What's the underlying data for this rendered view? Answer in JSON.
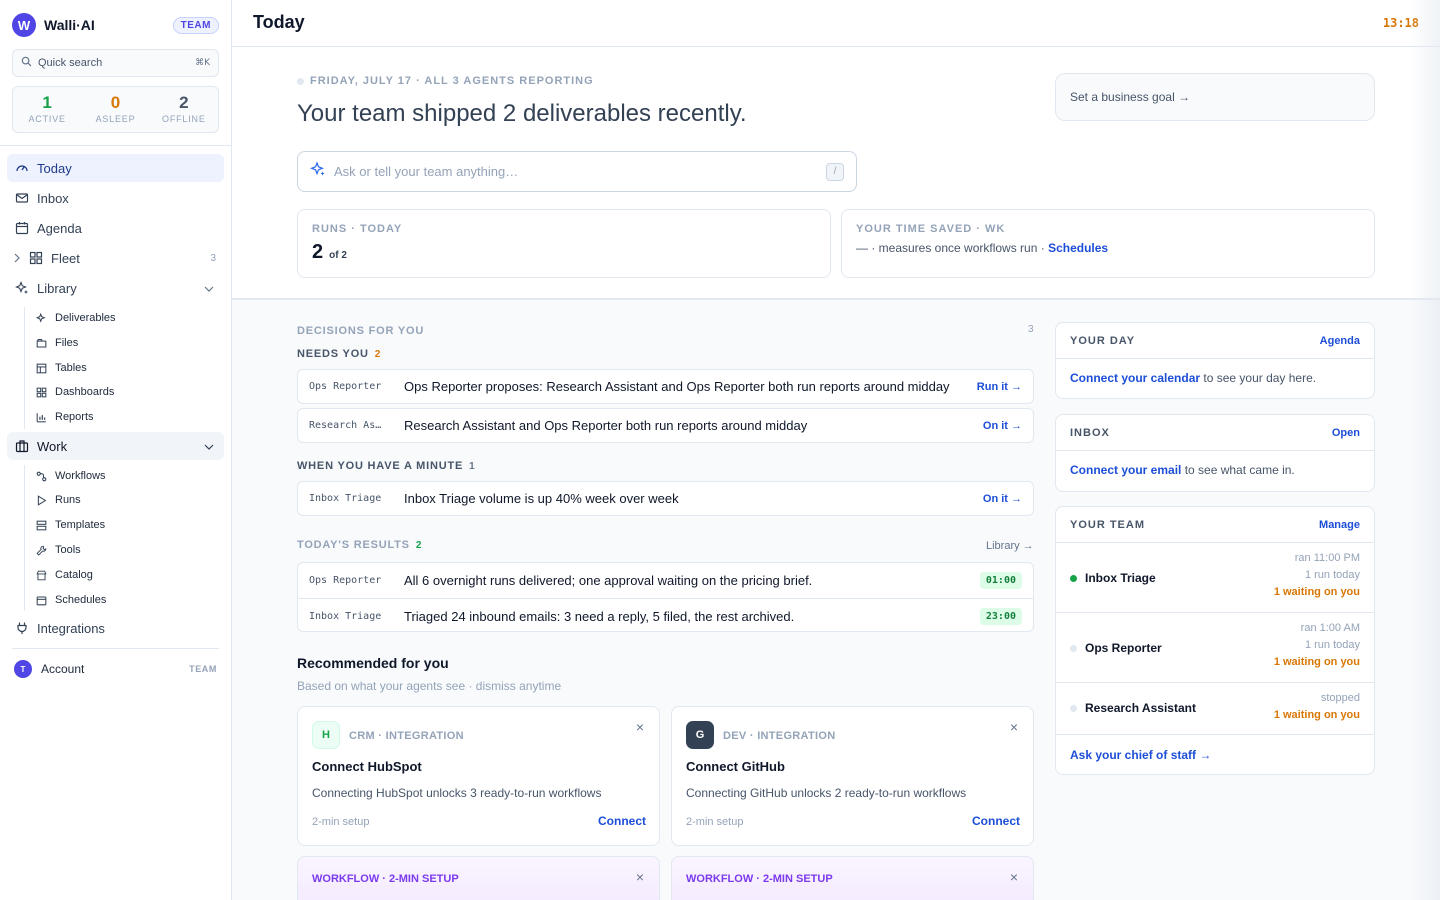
{
  "sidebar": {
    "brand_logo": "W",
    "brand_name": "Walli·AI",
    "team_badge": "TEAM",
    "quick_search": {
      "label": "Quick search",
      "shortcut": "⌘K"
    },
    "status": [
      {
        "count": "1",
        "label": "ACTIVE",
        "color": "#16a34a"
      },
      {
        "count": "0",
        "label": "ASLEEP",
        "color": "#d97706"
      },
      {
        "count": "2",
        "label": "OFFLINE",
        "color": "#475569"
      }
    ],
    "nav": {
      "today": "Today",
      "inbox": "Inbox",
      "agenda": "Agenda",
      "fleet": "Fleet",
      "fleet_count": "3",
      "library": "Library",
      "library_items": [
        "Deliverables",
        "Files",
        "Tables",
        "Dashboards",
        "Reports"
      ],
      "work": "Work",
      "work_items": [
        "Workflows",
        "Runs",
        "Templates",
        "Tools",
        "Catalog",
        "Schedules"
      ],
      "integrations": "Integrations"
    },
    "account": {
      "initial": "T",
      "label": "Account",
      "badge": "TEAM"
    }
  },
  "topbar": {
    "title": "Today",
    "clock": "13:18"
  },
  "hero": {
    "eyebrow": "FRIDAY, JULY 17 · ALL 3 AGENTS REPORTING",
    "headline": "Your team shipped 2 deliverables recently.",
    "goal_button": "Set a business goal →",
    "ask_placeholder": "Ask or tell your team anything…",
    "ask_shortcut": "/",
    "runs": {
      "label": "RUNS · TODAY",
      "value": "2",
      "sub": "of 2"
    },
    "time_saved": {
      "label": "YOUR TIME SAVED · WK",
      "text": "— · measures once workflows run ·",
      "link": "Schedules"
    }
  },
  "decisions": {
    "label": "DECISIONS FOR YOU",
    "count": "3",
    "needs_you": {
      "label": "NEEDS YOU",
      "count": "2",
      "rows": [
        {
          "agent": "Ops Reporter",
          "text": "Ops Reporter proposes: Research Assistant and Ops Reporter both run reports around midday",
          "action": "Run it →"
        },
        {
          "agent": "Research As…",
          "text": "Research Assistant and Ops Reporter both run reports around midday",
          "action": "On it →"
        }
      ]
    },
    "when_minute": {
      "label": "WHEN YOU HAVE A MINUTE",
      "count": "1",
      "rows": [
        {
          "agent": "Inbox Triage",
          "text": "Inbox Triage volume is up 40% week over week",
          "action": "On it →"
        }
      ]
    }
  },
  "results": {
    "label": "TODAY'S RESULTS",
    "count": "2",
    "link": "Library →",
    "rows": [
      {
        "agent": "Ops Reporter",
        "text": "All 6 overnight runs delivered; one approval waiting on the pricing brief.",
        "time": "01:00"
      },
      {
        "agent": "Inbox Triage",
        "text": "Triaged 24 inbound emails: 3 need a reply, 5 filed, the rest archived.",
        "time": "23:00"
      }
    ]
  },
  "recommended": {
    "title": "Recommended for you",
    "subtitle": "Based on what your agents see · dismiss anytime",
    "cards": [
      {
        "icon": "H",
        "kind": "CRM · INTEGRATION",
        "title": "Connect HubSpot",
        "desc": "Connecting HubSpot unlocks 3 ready-to-run workflows",
        "setup": "2-min setup",
        "action": "Connect",
        "close": "×"
      },
      {
        "icon": "G",
        "kind": "DEV · INTEGRATION",
        "title": "Connect GitHub",
        "desc": "Connecting GitHub unlocks 2 ready-to-run workflows",
        "setup": "2-min setup",
        "action": "Connect",
        "close": "×"
      }
    ],
    "workflows": [
      {
        "kind": "WORKFLOW · 2-MIN SETUP",
        "close": "×"
      },
      {
        "kind": "WORKFLOW · 2-MIN SETUP",
        "close": "×"
      }
    ]
  },
  "right": {
    "your_day": {
      "title": "YOUR DAY",
      "link": "Agenda",
      "cta": "Connect your calendar",
      "rest": " to see your day here."
    },
    "inbox": {
      "title": "INBOX",
      "link": "Open",
      "cta": "Connect your email",
      "rest": " to see what came in."
    },
    "team": {
      "title": "YOUR TEAM",
      "link": "Manage",
      "agents": [
        {
          "name": "Inbox Triage",
          "status": "active",
          "dot": "#16a34a",
          "meta1": "ran 11:00 PM",
          "meta2": "1 run today",
          "waiting": "1 waiting on you"
        },
        {
          "name": "Ops Reporter",
          "status": "offline",
          "dot": "#e2e8f0",
          "meta1": "ran 1:00 AM",
          "meta2": "1 run today",
          "waiting": "1 waiting on you"
        },
        {
          "name": "Research Assistant",
          "status": "offline",
          "dot": "#e2e8f0",
          "meta1": "stopped",
          "waiting": "1 waiting on you"
        }
      ],
      "chief_link": "Ask your chief of staff →"
    }
  }
}
